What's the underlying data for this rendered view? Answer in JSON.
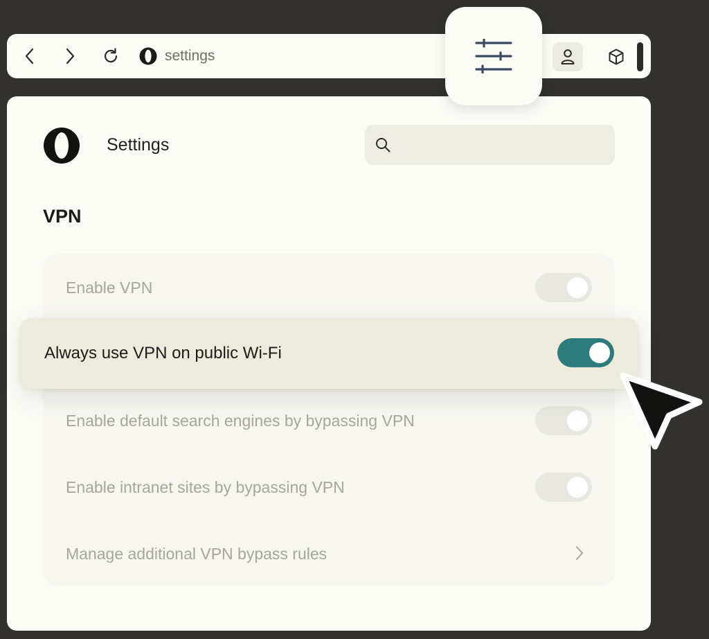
{
  "toolbar": {
    "back_icon": "chevron-left-icon",
    "forward_icon": "chevron-right-icon",
    "reload_icon": "reload-icon",
    "address_text": "settings",
    "profile_icon": "person-icon",
    "extensions_icon": "cube-icon",
    "customize_icon": "sliders-icon"
  },
  "header": {
    "title": "Settings",
    "search": {
      "placeholder": "",
      "value": ""
    }
  },
  "section": {
    "title": "VPN",
    "rows": [
      {
        "label": "Enable VPN",
        "type": "toggle",
        "on": true,
        "disabled": true
      },
      {
        "label": "Always use VPN on public Wi-Fi",
        "type": "toggle",
        "on": true,
        "highlighted": true
      },
      {
        "label": "Enable default search engines by bypassing VPN",
        "type": "toggle",
        "on": true,
        "disabled": true
      },
      {
        "label": "Enable intranet sites by bypassing VPN",
        "type": "toggle",
        "on": true,
        "disabled": true
      },
      {
        "label": "Manage additional VPN bypass rules",
        "type": "link",
        "disabled": true
      }
    ]
  },
  "colors": {
    "background": "#32312d",
    "surface": "#fcfcf7",
    "toggle_on": "#2e7b7e",
    "highlight": "#edebdc",
    "disabled_text": "#a6a59e"
  }
}
